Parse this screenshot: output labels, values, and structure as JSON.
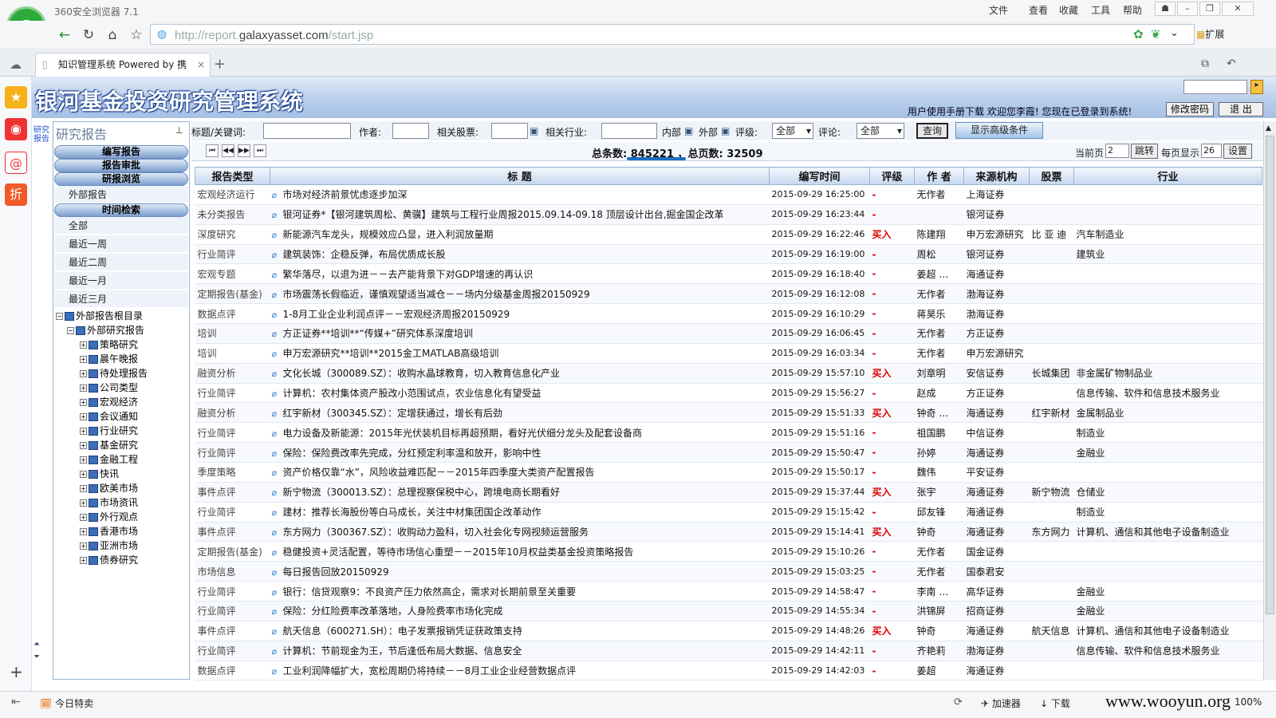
{
  "browser": {
    "app_title": "360安全浏览器 7.1",
    "menus": [
      "文件",
      "查看",
      "收藏",
      "工具",
      "帮助"
    ],
    "url_prefix": "http://report.",
    "url_domain": "galaxyasset.com",
    "url_path": "/start.jsp",
    "extension_label": "扩展",
    "tab_title": "知识管理系统 Powered by 携",
    "status_today": "今日特卖",
    "status_accelerator": "加速器",
    "status_download": "下载",
    "zoom": "100%",
    "watermark": "www.wooyun.org"
  },
  "header": {
    "title": "银河基金投资研究管理系统",
    "user_manual": "用户使用手册下载",
    "welcome": "欢迎您李霞!",
    "logged_in": "您现在已登录到系统!",
    "change_password": "修改密码",
    "logout": "退  出"
  },
  "left": {
    "vertical_label": "研究报告",
    "panel_title": "研究报告",
    "acc_write": "编写报告",
    "acc_review": "报告审批",
    "acc_browse": "研报浏览",
    "external": "外部报告",
    "acc_time": "时间检索",
    "time_items": [
      "全部",
      "最近一周",
      "最近二周",
      "最近一月",
      "最近三月"
    ],
    "tree_root": "外部报告根目录",
    "tree_sub": "外部研究报告",
    "tree_children": [
      "策略研究",
      "晨午晚报",
      "待处理报告",
      "公司类型",
      "宏观经济",
      "会议通知",
      "行业研究",
      "基金研究",
      "金融工程",
      "快讯",
      "欧美市场",
      "市场资讯",
      "外行观点",
      "香港市场",
      "亚洲市场",
      "债券研究"
    ]
  },
  "search": {
    "keyword_label": "标题/关键词:",
    "author_label": "作者:",
    "stock_label": "相关股票:",
    "industry_label": "相关行业:",
    "internal_label": "内部",
    "external_label": "外部",
    "rating_label": "评级:",
    "rating_value": "全部",
    "comment_label": "评论:",
    "comment_value": "全部",
    "query_btn": "查询",
    "advanced_btn": "显示高级条件"
  },
  "pager": {
    "total_label": "总条数:",
    "total": "845221",
    "pages_label": "，总页数:",
    "pages": "32509",
    "current_label": "当前页",
    "current": "2",
    "jump_btn": "跳转",
    "per_page_label": "每页显示",
    "per_page": "26",
    "settings_btn": "设置"
  },
  "table": {
    "headers": [
      "报告类型",
      "标  题",
      "编写时间",
      "评级",
      "作 者",
      "来源机构",
      "股票",
      "行业"
    ],
    "rows": [
      [
        "宏观经济运行",
        "市场对经济前景忧虑逐步加深",
        "2015-09-29 16:25:00",
        "-",
        "无作者",
        "上海证券",
        "",
        ""
      ],
      [
        "未分类报告",
        "银河证券*【银河建筑周松、黄骥】建筑与工程行业周报2015.09.14-09.18 顶层设计出台,掘金国企改革",
        "2015-09-29 16:23:44",
        "-",
        "",
        "银河证券",
        "",
        ""
      ],
      [
        "深度研究",
        "新能源汽车龙头，规模效应凸显，进入利润放量期",
        "2015-09-29 16:22:46",
        "买入",
        "陈建翔",
        "申万宏源研究",
        "比 亚 迪",
        "汽车制造业"
      ],
      [
        "行业简评",
        "建筑装饰：企稳反弹，布局优质成长股",
        "2015-09-29 16:19:00",
        "-",
        "周松",
        "银河证券",
        "",
        "建筑业"
      ],
      [
        "宏观专题",
        "繁华落尽，以退为进－－去产能背景下对GDP增速的再认识",
        "2015-09-29 16:18:40",
        "-",
        "姜超 …",
        "海通证券",
        "",
        ""
      ],
      [
        "定期报告(基金)",
        "市场震荡长假临近，谨慎观望适当减仓－－场内分级基金周报20150929",
        "2015-09-29 16:12:08",
        "-",
        "无作者",
        "渤海证券",
        "",
        ""
      ],
      [
        "数据点评",
        "1-8月工业企业利润点评－－宏观经济周报20150929",
        "2015-09-29 16:10:29",
        "-",
        "蒋昊乐",
        "渤海证券",
        "",
        ""
      ],
      [
        "培训",
        "方正证券**培训**“传媒+”研究体系深度培训",
        "2015-09-29 16:06:45",
        "-",
        "无作者",
        "方正证券",
        "",
        ""
      ],
      [
        "培训",
        "申万宏源研究**培训**2015金工MATLAB高级培训",
        "2015-09-29 16:03:34",
        "-",
        "无作者",
        "申万宏源研究",
        "",
        ""
      ],
      [
        "融资分析",
        "文化长城（300089.SZ）：收购水晶球教育，切入教育信息化产业",
        "2015-09-29 15:57:10",
        "买入",
        "刘章明",
        "安信证券",
        "长城集团",
        "非金属矿物制品业"
      ],
      [
        "行业简评",
        "计算机：农村集体资产股改小范围试点，农业信息化有望受益",
        "2015-09-29 15:56:27",
        "-",
        "赵成",
        "方正证券",
        "",
        "信息传输、软件和信息技术服务业"
      ],
      [
        "融资分析",
        "红宇新材（300345.SZ）：定增获通过，增长有后劲",
        "2015-09-29 15:51:33",
        "买入",
        "钟奇 …",
        "海通证券",
        "红宇新材",
        "金属制品业"
      ],
      [
        "行业简评",
        "电力设备及新能源：2015年光伏装机目标再超预期，看好光伏细分龙头及配套设备商",
        "2015-09-29 15:51:16",
        "-",
        "祖国鹏",
        "中信证券",
        "",
        "制造业"
      ],
      [
        "行业简评",
        "保险：保险费改率先完成，分红预定利率温和放开，影响中性",
        "2015-09-29 15:50:47",
        "-",
        "孙婷",
        "海通证券",
        "",
        "金融业"
      ],
      [
        "季度策略",
        "资产价格仅靠“水”，风险收益难匹配－－2015年四季度大类资产配置报告",
        "2015-09-29 15:50:17",
        "-",
        "魏伟",
        "平安证券",
        "",
        ""
      ],
      [
        "事件点评",
        "新宁物流（300013.SZ）：总理视察保税中心，跨境电商长期看好",
        "2015-09-29 15:37:44",
        "买入",
        "张宇",
        "海通证券",
        "新宁物流",
        "仓储业"
      ],
      [
        "行业简评",
        "建材：推荐长海股份等白马成长，关注中材集团国企改革动作",
        "2015-09-29 15:15:42",
        "-",
        "邱友锋",
        "海通证券",
        "",
        "制造业"
      ],
      [
        "事件点评",
        "东方网力（300367.SZ）：收购动力盈科，切入社会化专网视频运营服务",
        "2015-09-29 15:14:41",
        "买入",
        "钟奇",
        "海通证券",
        "东方网力",
        "计算机、通信和其他电子设备制造业"
      ],
      [
        "定期报告(基金)",
        "稳健投资+灵活配置，等待市场信心重塑－－2015年10月权益类基金投资策略报告",
        "2015-09-29 15:10:26",
        "-",
        "无作者",
        "国金证券",
        "",
        ""
      ],
      [
        "市场信息",
        "每日报告回放20150929",
        "2015-09-29 15:03:25",
        "-",
        "无作者",
        "国泰君安",
        "",
        ""
      ],
      [
        "行业简评",
        "银行：信贷观察9：不良资产压力依然高企，需求对长期前景至关重要",
        "2015-09-29 14:58:47",
        "-",
        "李南 …",
        "高华证券",
        "",
        "金融业"
      ],
      [
        "行业简评",
        "保险：分红险费率改革落地，人身险费率市场化完成",
        "2015-09-29 14:55:34",
        "-",
        "洪锦屏",
        "招商证券",
        "",
        "金融业"
      ],
      [
        "事件点评",
        "航天信息（600271.SH）：电子发票报销凭证获政策支持",
        "2015-09-29 14:48:26",
        "买入",
        "钟奇",
        "海通证券",
        "航天信息",
        "计算机、通信和其他电子设备制造业"
      ],
      [
        "行业简评",
        "计算机：节前现金为王，节后逢低布局大数据、信息安全",
        "2015-09-29 14:42:11",
        "-",
        "齐艳莉",
        "渤海证券",
        "",
        "信息传输、软件和信息技术服务业"
      ],
      [
        "数据点评",
        "工业利润降幅扩大，宽松周期仍将持续－－8月工业企业经营数据点评",
        "2015-09-29 14:42:03",
        "-",
        "姜超",
        "海通证券",
        "",
        ""
      ]
    ]
  }
}
